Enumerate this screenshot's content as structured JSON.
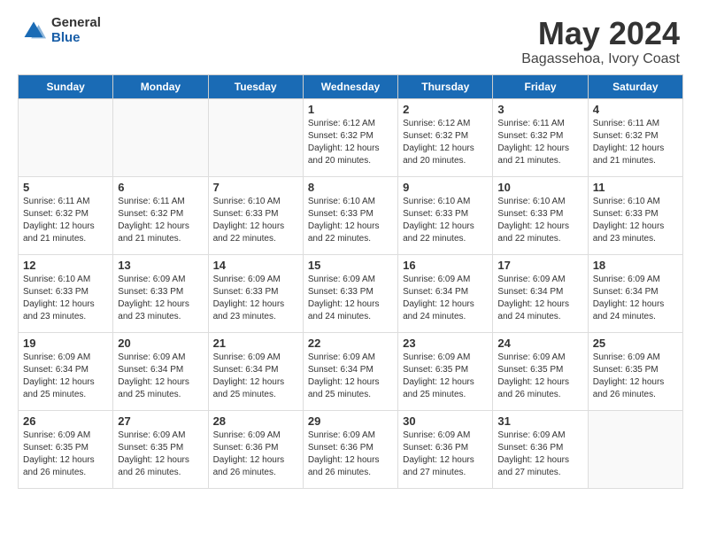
{
  "logo": {
    "general": "General",
    "blue": "Blue"
  },
  "header": {
    "title": "May 2024",
    "subtitle": "Bagassehoa, Ivory Coast"
  },
  "days_of_week": [
    "Sunday",
    "Monday",
    "Tuesday",
    "Wednesday",
    "Thursday",
    "Friday",
    "Saturday"
  ],
  "weeks": [
    [
      {
        "day": "",
        "info": ""
      },
      {
        "day": "",
        "info": ""
      },
      {
        "day": "",
        "info": ""
      },
      {
        "day": "1",
        "info": "Sunrise: 6:12 AM\nSunset: 6:32 PM\nDaylight: 12 hours\nand 20 minutes."
      },
      {
        "day": "2",
        "info": "Sunrise: 6:12 AM\nSunset: 6:32 PM\nDaylight: 12 hours\nand 20 minutes."
      },
      {
        "day": "3",
        "info": "Sunrise: 6:11 AM\nSunset: 6:32 PM\nDaylight: 12 hours\nand 21 minutes."
      },
      {
        "day": "4",
        "info": "Sunrise: 6:11 AM\nSunset: 6:32 PM\nDaylight: 12 hours\nand 21 minutes."
      }
    ],
    [
      {
        "day": "5",
        "info": "Sunrise: 6:11 AM\nSunset: 6:32 PM\nDaylight: 12 hours\nand 21 minutes."
      },
      {
        "day": "6",
        "info": "Sunrise: 6:11 AM\nSunset: 6:32 PM\nDaylight: 12 hours\nand 21 minutes."
      },
      {
        "day": "7",
        "info": "Sunrise: 6:10 AM\nSunset: 6:33 PM\nDaylight: 12 hours\nand 22 minutes."
      },
      {
        "day": "8",
        "info": "Sunrise: 6:10 AM\nSunset: 6:33 PM\nDaylight: 12 hours\nand 22 minutes."
      },
      {
        "day": "9",
        "info": "Sunrise: 6:10 AM\nSunset: 6:33 PM\nDaylight: 12 hours\nand 22 minutes."
      },
      {
        "day": "10",
        "info": "Sunrise: 6:10 AM\nSunset: 6:33 PM\nDaylight: 12 hours\nand 22 minutes."
      },
      {
        "day": "11",
        "info": "Sunrise: 6:10 AM\nSunset: 6:33 PM\nDaylight: 12 hours\nand 23 minutes."
      }
    ],
    [
      {
        "day": "12",
        "info": "Sunrise: 6:10 AM\nSunset: 6:33 PM\nDaylight: 12 hours\nand 23 minutes."
      },
      {
        "day": "13",
        "info": "Sunrise: 6:09 AM\nSunset: 6:33 PM\nDaylight: 12 hours\nand 23 minutes."
      },
      {
        "day": "14",
        "info": "Sunrise: 6:09 AM\nSunset: 6:33 PM\nDaylight: 12 hours\nand 23 minutes."
      },
      {
        "day": "15",
        "info": "Sunrise: 6:09 AM\nSunset: 6:33 PM\nDaylight: 12 hours\nand 24 minutes."
      },
      {
        "day": "16",
        "info": "Sunrise: 6:09 AM\nSunset: 6:34 PM\nDaylight: 12 hours\nand 24 minutes."
      },
      {
        "day": "17",
        "info": "Sunrise: 6:09 AM\nSunset: 6:34 PM\nDaylight: 12 hours\nand 24 minutes."
      },
      {
        "day": "18",
        "info": "Sunrise: 6:09 AM\nSunset: 6:34 PM\nDaylight: 12 hours\nand 24 minutes."
      }
    ],
    [
      {
        "day": "19",
        "info": "Sunrise: 6:09 AM\nSunset: 6:34 PM\nDaylight: 12 hours\nand 25 minutes."
      },
      {
        "day": "20",
        "info": "Sunrise: 6:09 AM\nSunset: 6:34 PM\nDaylight: 12 hours\nand 25 minutes."
      },
      {
        "day": "21",
        "info": "Sunrise: 6:09 AM\nSunset: 6:34 PM\nDaylight: 12 hours\nand 25 minutes."
      },
      {
        "day": "22",
        "info": "Sunrise: 6:09 AM\nSunset: 6:34 PM\nDaylight: 12 hours\nand 25 minutes."
      },
      {
        "day": "23",
        "info": "Sunrise: 6:09 AM\nSunset: 6:35 PM\nDaylight: 12 hours\nand 25 minutes."
      },
      {
        "day": "24",
        "info": "Sunrise: 6:09 AM\nSunset: 6:35 PM\nDaylight: 12 hours\nand 26 minutes."
      },
      {
        "day": "25",
        "info": "Sunrise: 6:09 AM\nSunset: 6:35 PM\nDaylight: 12 hours\nand 26 minutes."
      }
    ],
    [
      {
        "day": "26",
        "info": "Sunrise: 6:09 AM\nSunset: 6:35 PM\nDaylight: 12 hours\nand 26 minutes."
      },
      {
        "day": "27",
        "info": "Sunrise: 6:09 AM\nSunset: 6:35 PM\nDaylight: 12 hours\nand 26 minutes."
      },
      {
        "day": "28",
        "info": "Sunrise: 6:09 AM\nSunset: 6:36 PM\nDaylight: 12 hours\nand 26 minutes."
      },
      {
        "day": "29",
        "info": "Sunrise: 6:09 AM\nSunset: 6:36 PM\nDaylight: 12 hours\nand 26 minutes."
      },
      {
        "day": "30",
        "info": "Sunrise: 6:09 AM\nSunset: 6:36 PM\nDaylight: 12 hours\nand 27 minutes."
      },
      {
        "day": "31",
        "info": "Sunrise: 6:09 AM\nSunset: 6:36 PM\nDaylight: 12 hours\nand 27 minutes."
      },
      {
        "day": "",
        "info": ""
      }
    ]
  ]
}
